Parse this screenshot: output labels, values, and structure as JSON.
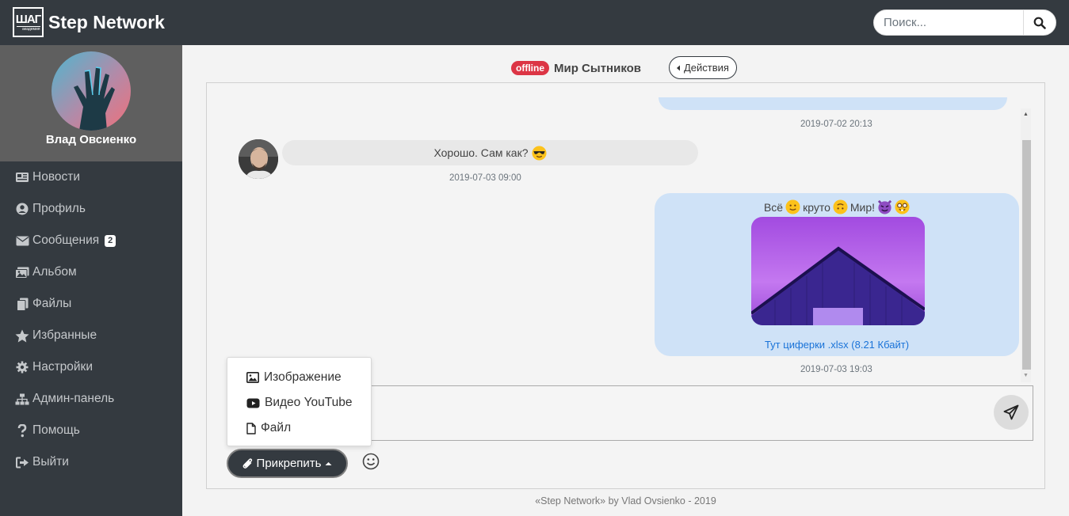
{
  "header": {
    "logo_text": "ШАГ",
    "logo_subtext": "академия",
    "brand": "Step Network",
    "search_placeholder": "Поиск..."
  },
  "sidebar": {
    "user_name": "Влад Овсиенко",
    "items": [
      {
        "label": "Новости",
        "icon": "newspaper-icon"
      },
      {
        "label": "Профиль",
        "icon": "user-circle-icon"
      },
      {
        "label": "Сообщения",
        "icon": "envelope-icon",
        "badge": "2"
      },
      {
        "label": "Альбом",
        "icon": "images-icon"
      },
      {
        "label": "Файлы",
        "icon": "files-icon"
      },
      {
        "label": "Избранные",
        "icon": "star-icon"
      },
      {
        "label": "Настройки",
        "icon": "gear-icon"
      },
      {
        "label": "Админ-панель",
        "icon": "sitemap-icon"
      },
      {
        "label": "Помощь",
        "icon": "question-icon"
      },
      {
        "label": "Выйти",
        "icon": "sign-out-icon"
      }
    ]
  },
  "chat": {
    "status": "offline",
    "peer_name": "Мир Сытников",
    "actions_label": "Действия",
    "messages": [
      {
        "timestamp": "2019-07-02 20:13"
      },
      {
        "text": "Хорошо. Сам как?",
        "emoji": "sunglasses-emoji",
        "timestamp": "2019-07-03 09:00"
      },
      {
        "text_parts": [
          "Всё",
          "круто",
          "Мир!"
        ],
        "emojis": [
          "slight-smile-emoji",
          "upside-down-emoji",
          "devil-emoji",
          "nerd-emoji"
        ],
        "file": "Тут циферки .xlsx (8.21 Кбайт)",
        "timestamp": "2019-07-03 19:03"
      }
    ]
  },
  "composer": {
    "attach_label": "Прикрепить",
    "menu": [
      "Изображение",
      "Видео YouTube",
      "Файл"
    ]
  },
  "footer": "«Step Network» by Vlad Ovsienko - 2019",
  "colors": {
    "dark": "#343a40",
    "offline": "#dc3545",
    "bubble_out": "#cfe2f7",
    "bubble_in": "#e8e8e8",
    "link": "#1a73d8"
  }
}
